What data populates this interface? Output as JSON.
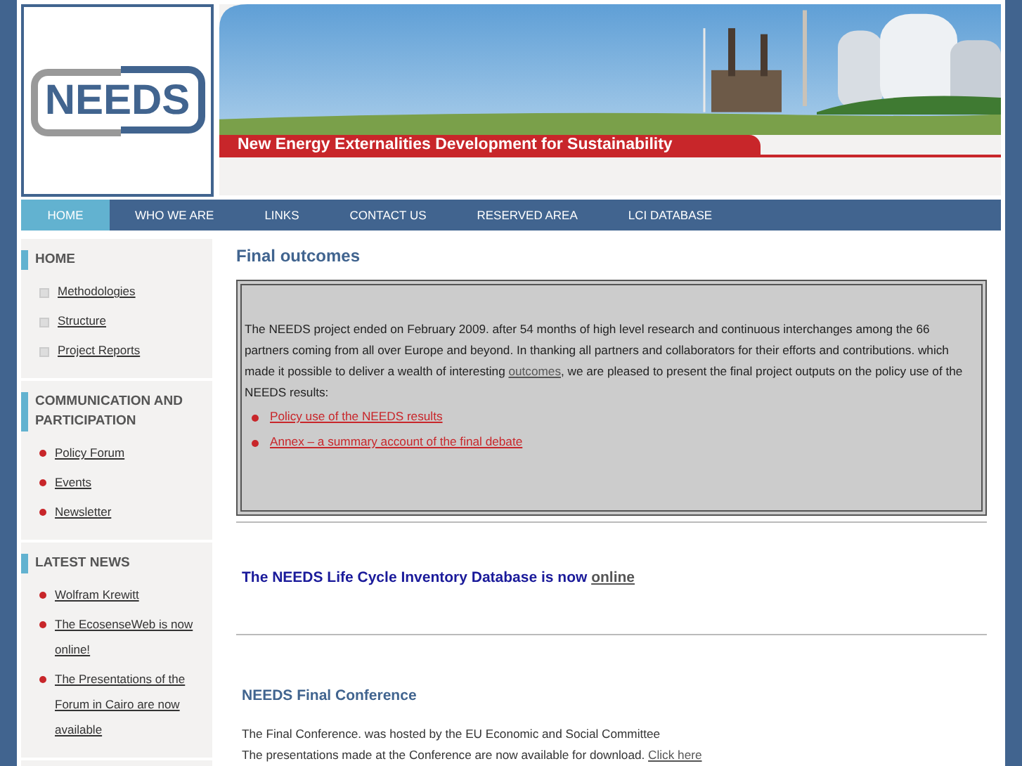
{
  "logo": {
    "text": "NEEDS"
  },
  "banner": {
    "kind": "picture",
    "tagline": "New Energy Externalities Development for Sustainability"
  },
  "nav": [
    {
      "label": "HOME",
      "selected": true
    },
    {
      "label": "WHO WE ARE",
      "selected": false
    },
    {
      "label": "LINKS",
      "selected": false
    },
    {
      "label": "CONTACT US",
      "selected": false
    },
    {
      "label": "RESERVED AREA",
      "selected": false
    },
    {
      "label": "LCI DATABASE",
      "selected": false
    }
  ],
  "sidebar": [
    {
      "title": "HOME",
      "kind": "square",
      "items": [
        "Methodologies",
        "Structure",
        "Project Reports"
      ]
    },
    {
      "title": "COMMUNICATION AND PARTICIPATION",
      "kind": "dot",
      "items": [
        "Policy Forum",
        "Events",
        "Newsletter"
      ]
    },
    {
      "title": "LATEST NEWS",
      "kind": "dot",
      "items": [
        "Wolfram Krewitt",
        "The EcosenseWeb is now online!",
        "The Presentations of the Forum in Cairo are now available"
      ]
    }
  ],
  "main": {
    "heading": "Final outcomes",
    "box": {
      "text_before": "The NEEDS project ended on February 2009. after 54 months of high level research and continuous interchanges among the 66 partners coming from all over Europe and beyond. In thanking all partners and collaborators for their efforts and contributions. which made it possible to deliver a wealth of interesting ",
      "link": "outcomes",
      "text_after": ", we are pleased to present the final project outputs on the policy use of the NEEDS results:",
      "links": [
        "Policy use of the NEEDS results",
        "Annex – a summary account of the final debate"
      ]
    },
    "announcement": {
      "text": "The NEEDS Life Cycle Inventory Database is now ",
      "link": "online"
    },
    "conference": {
      "heading": "NEEDS Final Conference",
      "line1": "The Final Conference. was hosted by the EU Economic and Social Committee",
      "line2": "The presentations made at the Conference are now available for download. ",
      "link": "Click here"
    }
  }
}
